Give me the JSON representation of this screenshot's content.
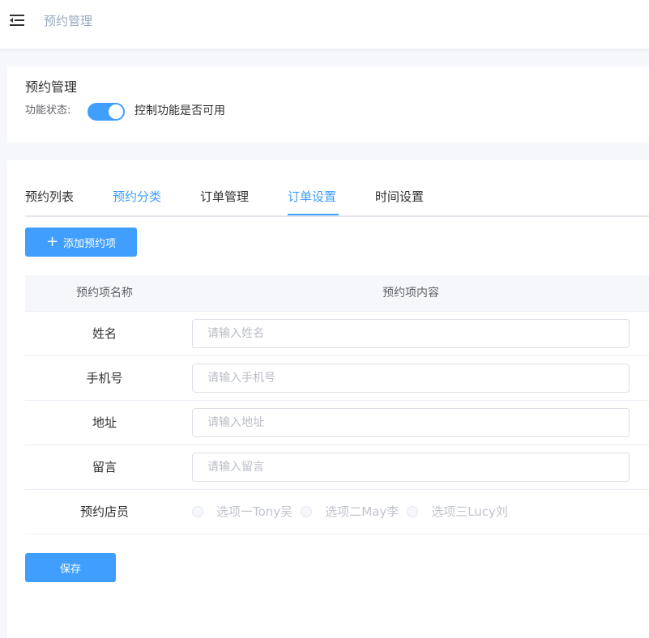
{
  "header": {
    "breadcrumb": "预约管理"
  },
  "module": {
    "title": "预约管理",
    "status_label": "功能状态:",
    "switch_on": true,
    "status_desc": "控制功能是否可用"
  },
  "tabs": [
    {
      "label": "预约列表"
    },
    {
      "label": "预约分类"
    },
    {
      "label": "订单管理"
    },
    {
      "label": "订单设置"
    },
    {
      "label": "时间设置"
    }
  ],
  "active_tab": "订单设置",
  "add_button": {
    "label": "添加预约项"
  },
  "table": {
    "headers": {
      "name": "预约项名称",
      "content": "预约项内容"
    },
    "rows": [
      {
        "name": "姓名",
        "placeholder": "请输入姓名"
      },
      {
        "name": "手机号",
        "placeholder": "请输入手机号"
      },
      {
        "name": "地址",
        "placeholder": "请输入地址"
      },
      {
        "name": "留言",
        "placeholder": "请输入留言"
      }
    ],
    "staff_row": {
      "name": "预约店员",
      "options": [
        "选项一Tony吴",
        "选项二May李",
        "选项三Lucy刘"
      ]
    }
  },
  "save_button": {
    "label": "保存"
  },
  "colors": {
    "accent": "#409eff",
    "muted_text": "#97a8be"
  }
}
